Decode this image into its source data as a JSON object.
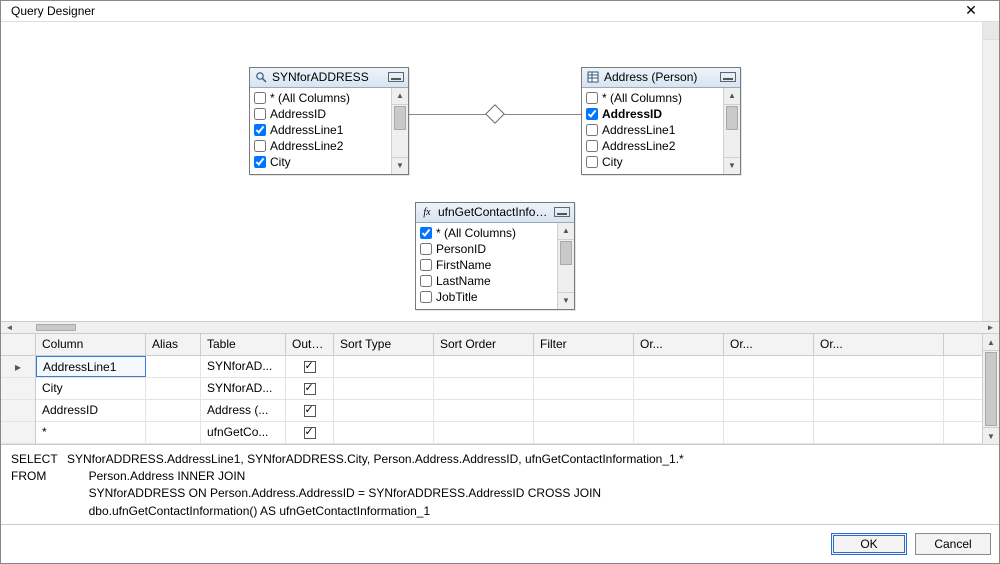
{
  "window": {
    "title": "Query Designer",
    "close_label": "✕"
  },
  "panels": {
    "syn": {
      "title": "SYNforADDRESS",
      "icon": "magnifier",
      "columns": [
        {
          "label": "* (All Columns)",
          "checked": false
        },
        {
          "label": "AddressID",
          "checked": false
        },
        {
          "label": "AddressLine1",
          "checked": true
        },
        {
          "label": "AddressLine2",
          "checked": false
        },
        {
          "label": "City",
          "checked": true
        }
      ]
    },
    "addr": {
      "title": "Address (Person)",
      "icon": "table",
      "columns": [
        {
          "label": "* (All Columns)",
          "checked": false
        },
        {
          "label": "AddressID",
          "checked": true,
          "bold": true
        },
        {
          "label": "AddressLine1",
          "checked": false
        },
        {
          "label": "AddressLine2",
          "checked": false
        },
        {
          "label": "City",
          "checked": false
        }
      ]
    },
    "ufn": {
      "title": "ufnGetContactInforma...",
      "icon": "fx",
      "columns": [
        {
          "label": "* (All Columns)",
          "checked": true
        },
        {
          "label": "PersonID",
          "checked": false
        },
        {
          "label": "FirstName",
          "checked": false
        },
        {
          "label": "LastName",
          "checked": false
        },
        {
          "label": "JobTitle",
          "checked": false
        }
      ]
    }
  },
  "grid": {
    "headers": [
      "Column",
      "Alias",
      "Table",
      "Outp...",
      "Sort Type",
      "Sort Order",
      "Filter",
      "Or...",
      "Or...",
      "Or..."
    ],
    "rows": [
      {
        "column": "AddressLine1",
        "alias": "",
        "table": "SYNforAD...",
        "output": true
      },
      {
        "column": "City",
        "alias": "",
        "table": "SYNforAD...",
        "output": true
      },
      {
        "column": "AddressID",
        "alias": "",
        "table": "Address (...",
        "output": true
      },
      {
        "column": "*",
        "alias": "",
        "table": "ufnGetCo...",
        "output": true
      }
    ]
  },
  "sql": {
    "select_kw": "SELECT",
    "select": "SYNforADDRESS.AddressLine1, SYNforADDRESS.City, Person.Address.AddressID, ufnGetContactInformation_1.*",
    "from_kw": "FROM",
    "from1": "Person.Address INNER JOIN",
    "from2": "SYNforADDRESS ON Person.Address.AddressID = SYNforADDRESS.AddressID CROSS JOIN",
    "from3": "dbo.ufnGetContactInformation() AS ufnGetContactInformation_1"
  },
  "buttons": {
    "ok": "OK",
    "cancel": "Cancel"
  }
}
